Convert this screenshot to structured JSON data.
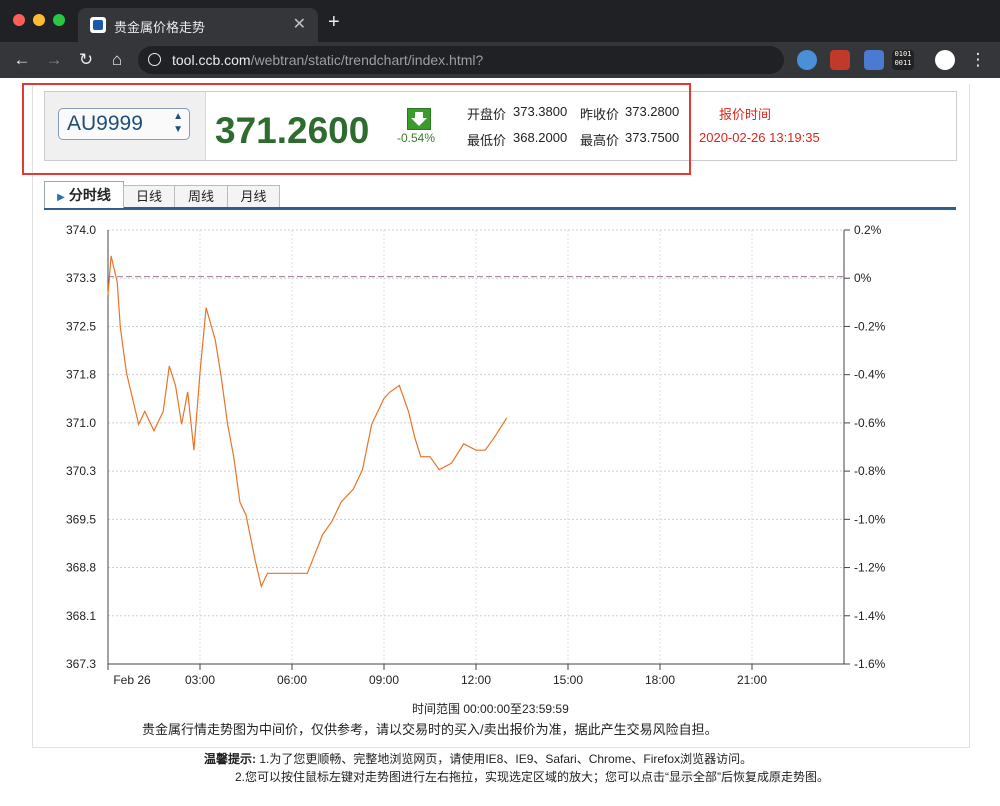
{
  "browser": {
    "tab_title": "贵金属价格走势",
    "url_host": "tool.ccb.com",
    "url_path": "/webtran/static/trendchart/index.html?",
    "tab_close_glyph": "✕",
    "new_tab_glyph": "+"
  },
  "panel": {
    "product": "AU9999",
    "price": "371.2600",
    "change_pct": "-0.54%",
    "open_label": "开盘价",
    "open_value": "373.3800",
    "prev_close_label": "昨收价",
    "prev_close_value": "373.2800",
    "low_label": "最低价",
    "low_value": "368.2000",
    "high_label": "最高价",
    "high_value": "373.7500",
    "quote_time_label": "报价时间",
    "quote_time": "2020-02-26 13:19:35",
    "colors": {
      "price": "#2e6b2e",
      "down_badge": "#3a9b2b",
      "time": "#e0241a"
    }
  },
  "tabs": [
    "分时线",
    "日线",
    "周线",
    "月线"
  ],
  "chart_data": {
    "type": "line",
    "y_left_ticks": [
      "374.0",
      "373.3",
      "372.5",
      "371.8",
      "371.0",
      "370.3",
      "369.5",
      "368.8",
      "368.1",
      "367.3"
    ],
    "y_right_ticks": [
      "0.2%",
      "0%",
      "-0.2%",
      "-0.4%",
      "-0.6%",
      "-0.8%",
      "-1.0%",
      "-1.2%",
      "-1.4%",
      "-1.6%"
    ],
    "x_ticks": [
      "Feb 26",
      "03:00",
      "06:00",
      "09:00",
      "12:00",
      "15:00",
      "18:00",
      "21:00"
    ],
    "ylim": [
      367.3,
      374.0
    ],
    "reference_line": 373.28,
    "line_color": "#e8742a",
    "series": [
      {
        "x": [
          0.0,
          0.1,
          0.2,
          0.3,
          0.4,
          0.6,
          0.8,
          1.0,
          1.2,
          1.5,
          1.8,
          2.0,
          2.2,
          2.4,
          2.6,
          2.8,
          3.0,
          3.2,
          3.5,
          3.7,
          3.9,
          4.1,
          4.3,
          4.5,
          4.8,
          5.0,
          5.2,
          5.5,
          5.8,
          6.0,
          6.5,
          7.0,
          7.3,
          7.6,
          8.0,
          8.3,
          8.6,
          9.0,
          9.2,
          9.5,
          9.8,
          10.0,
          10.2,
          10.5,
          10.8,
          11.2,
          11.6,
          12.0,
          12.3,
          12.6,
          13.0
        ],
        "y": [
          373.0,
          373.6,
          373.4,
          373.2,
          372.5,
          371.8,
          371.4,
          371.0,
          371.2,
          370.9,
          371.2,
          371.9,
          371.6,
          371.0,
          371.5,
          370.6,
          371.8,
          372.8,
          372.3,
          371.7,
          371.0,
          370.5,
          369.8,
          369.6,
          368.9,
          368.5,
          368.7,
          368.7,
          368.7,
          368.7,
          368.7,
          369.3,
          369.5,
          369.8,
          370.0,
          370.3,
          371.0,
          371.4,
          371.5,
          371.6,
          371.2,
          370.8,
          370.5,
          370.5,
          370.3,
          370.4,
          370.7,
          370.6,
          370.6,
          370.8,
          371.1
        ]
      }
    ],
    "x_range_label": "时间范围 00:00:00至23:59:59",
    "disclaimer": "贵金属行情走势图为中间价，仅供参考，请以交易时的买入/卖出报价为准，据此产生交易风险自担。"
  },
  "tips": {
    "label": "温馨提示:",
    "line1": " 1.为了您更顺畅、完整地浏览网页，请使用IE8、IE9、Safari、Chrome、Firefox浏览器访问。",
    "line2": "2.您可以按住鼠标左键对走势图进行左右拖拉，实现选定区域的放大；您可以点击“显示全部”后恢复成原走势图。"
  }
}
